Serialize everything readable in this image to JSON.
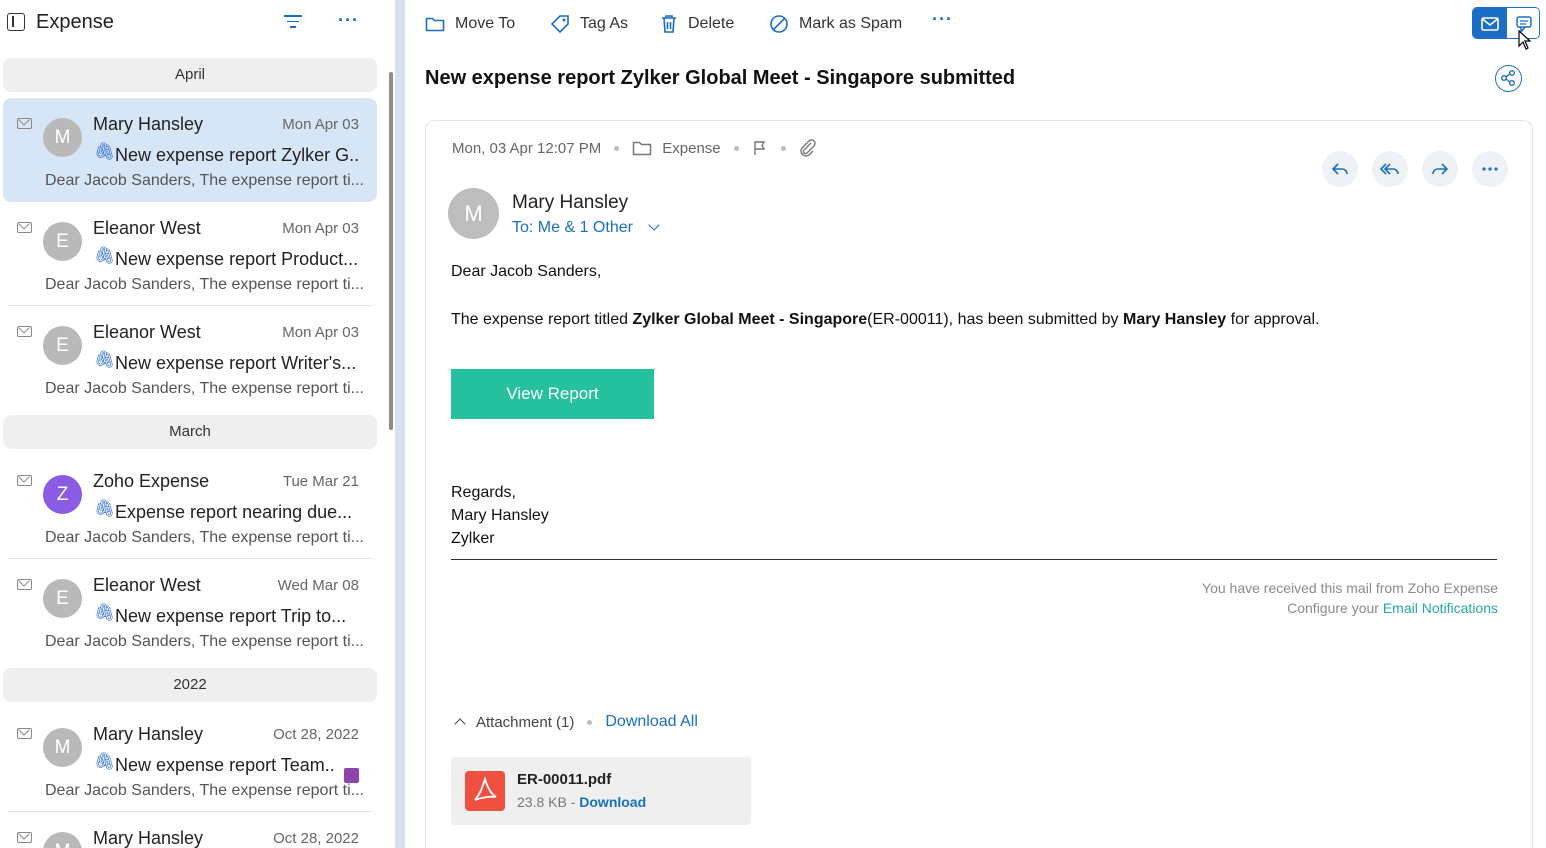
{
  "folder": {
    "title": "Expense"
  },
  "groups": [
    "April",
    "March",
    "2022"
  ],
  "mails": [
    {
      "avatar": "M",
      "sender": "Mary Hansley",
      "date": "Mon Apr 03",
      "subject": "New expense report Zylker G...",
      "preview": "Dear Jacob Sanders, The expense report ti..."
    },
    {
      "avatar": "E",
      "sender": "Eleanor West",
      "date": "Mon Apr 03",
      "subject": "New expense report Product...",
      "preview": "Dear Jacob Sanders, The expense report ti..."
    },
    {
      "avatar": "E",
      "sender": "Eleanor West",
      "date": "Mon Apr 03",
      "subject": "New expense report Writer's...",
      "preview": "Dear Jacob Sanders, The expense report ti..."
    },
    {
      "avatar": "Z",
      "sender": "Zoho Expense",
      "date": "Tue Mar 21",
      "subject": "Expense report nearing due...",
      "preview": "Dear Jacob Sanders, The expense report ti..."
    },
    {
      "avatar": "E",
      "sender": "Eleanor West",
      "date": "Wed Mar 08",
      "subject": "New expense report Trip to...",
      "preview": "Dear Jacob Sanders, The expense report ti..."
    },
    {
      "avatar": "M",
      "sender": "Mary Hansley",
      "date": "Oct 28, 2022",
      "subject": "New expense report Team...",
      "preview": "Dear Jacob Sanders, The expense report ti..."
    },
    {
      "avatar": "M",
      "sender": "Mary Hansley",
      "date": "Oct 28, 2022",
      "subject": "",
      "preview": ""
    }
  ],
  "toolbar": {
    "move_to": "Move To",
    "tag_as": "Tag As",
    "delete": "Delete",
    "mark_spam": "Mark as Spam",
    "more": "···"
  },
  "message": {
    "title": "New expense report Zylker Global Meet - Singapore submitted",
    "datetime": "Mon, 03 Apr 12:07 PM",
    "folder": "Expense",
    "sender_avatar": "M",
    "sender_name": "Mary Hansley",
    "to": "To: Me & 1 Other",
    "greeting": "Dear Jacob Sanders,",
    "body": {
      "p1_start": "The expense report titled ",
      "report_name": "Zylker Global Meet - Singapore",
      "report_id": "(ER-00011), has been submitted by ",
      "submitter": "Mary Hansley",
      "p1_end": " for approval."
    },
    "view_report": "View Report",
    "regards": "Regards,",
    "sig_name": "Mary Hansley",
    "sig_company": "Zylker",
    "footer_line1": "You have received this mail from Zoho Expense",
    "footer_line2_prefix": "Configure your ",
    "footer_link": "Email Notifications"
  },
  "attachments": {
    "header": "Attachment (1)",
    "download_all": "Download All",
    "file_name": "ER-00011.pdf",
    "file_size": "23.8 KB - ",
    "download": "Download"
  },
  "colors": {
    "accent": "#1a6fc4",
    "button": "#25c09e",
    "selected": "#d6e6f7",
    "avatar_zoho": "#8a5ce6",
    "tag": "#8e44ad"
  }
}
